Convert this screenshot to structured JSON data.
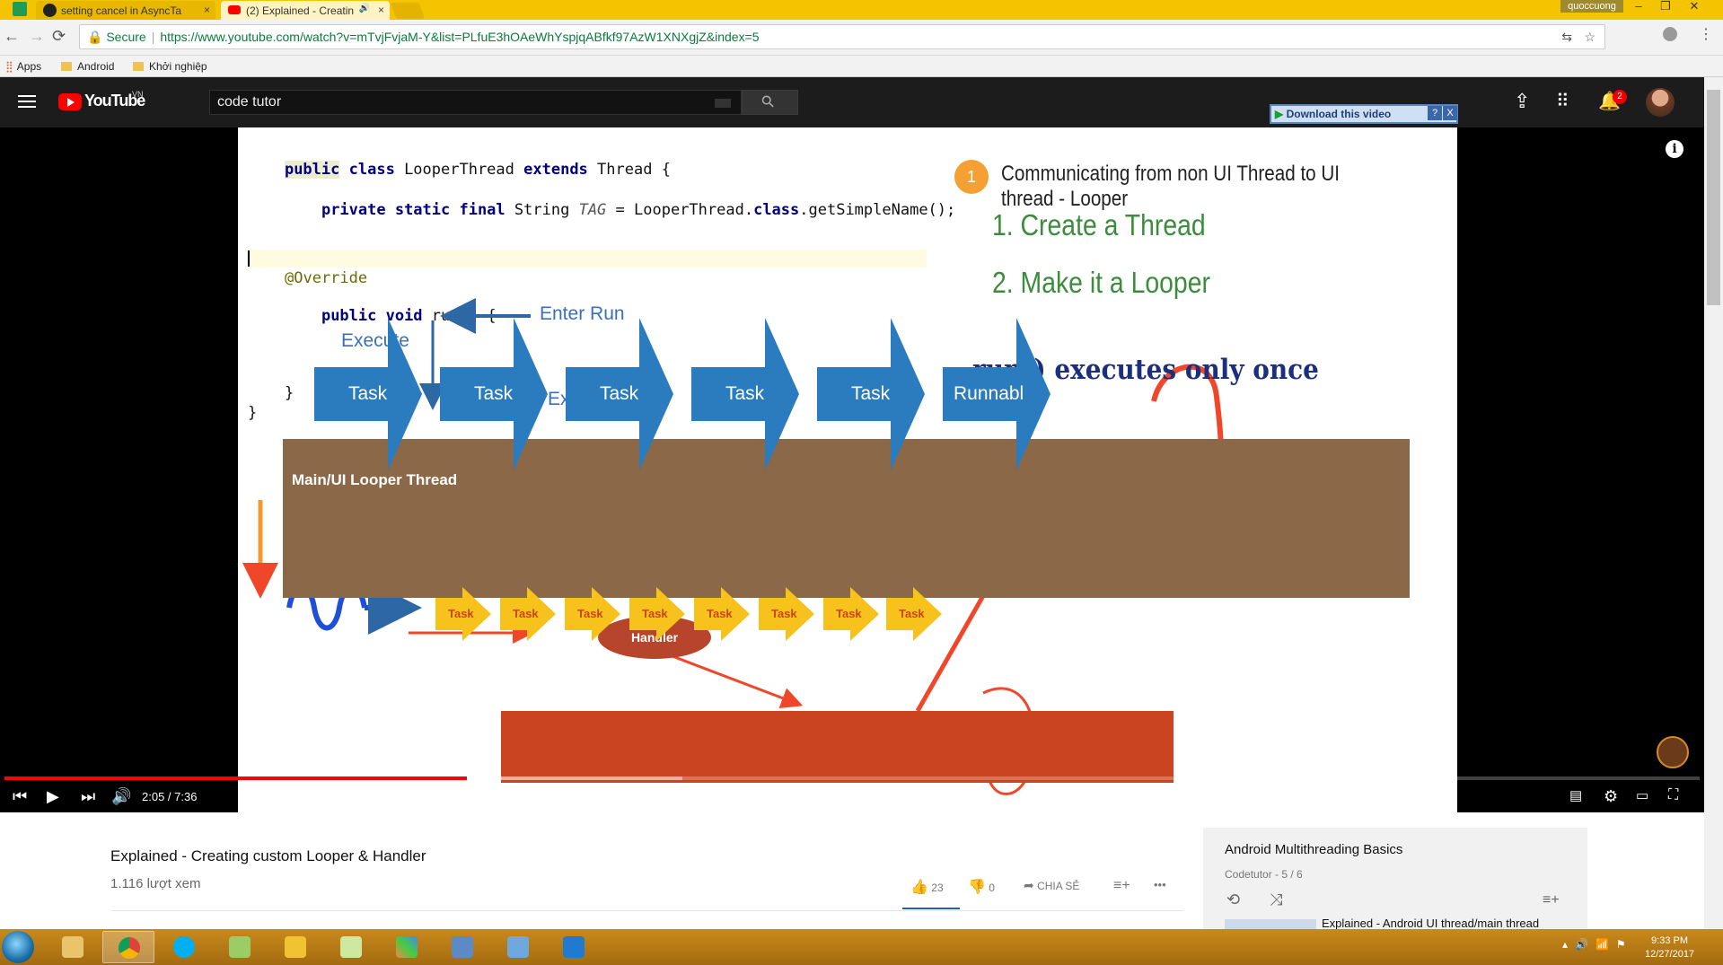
{
  "browser": {
    "tabs": [
      {
        "title": "setting cancel in AsyncTa",
        "icon": "github-icon",
        "close": "×"
      },
      {
        "title": "(2) Explained - Creatin",
        "icon": "youtube-icon",
        "close": "×",
        "audio": "🔊"
      }
    ],
    "user": "quoccuong",
    "window_controls": [
      "–",
      "❐",
      "✕"
    ],
    "nav": {
      "back": "←",
      "forward": "→",
      "reload": "⟳"
    },
    "secure_label": "Secure",
    "url": "https://www.youtube.com/watch?v=mTvjFvjaM-Y&list=PLfuE3hOAeWhYspjqABfkf97AzW1XNXgjZ&index=5",
    "bookmarks": [
      {
        "label": "Apps",
        "icon": "apps-grid-icon"
      },
      {
        "label": "Android",
        "icon": "folder-icon"
      },
      {
        "label": "Khởi nghiệp",
        "icon": "folder-icon"
      }
    ]
  },
  "youtube": {
    "logo_text": "YouTube",
    "region": "VN",
    "search_value": "code tutor",
    "download_button": "Download this video",
    "download_help": "?",
    "download_close": "X",
    "notification_count": "2"
  },
  "slide": {
    "code": {
      "line1_kw1": "public",
      "line1_kw2": "class",
      "line1_name": "LooperThread",
      "line1_kw3": "extends",
      "line1_rest": "Thread {",
      "line2_kw": "private static final",
      "line2_type": "String",
      "line2_tag": "TAG",
      "line2_mid": "= LooperThread.",
      "line2_kw2": "class",
      "line2_end": ".getSimpleName();",
      "override": "@Override",
      "run_kw": "public void",
      "run_rest": "run() {",
      "close_inner": "}",
      "close_outer": "}"
    },
    "enter_run": "Enter Run",
    "execute": "Execute",
    "exit_run": "Exit Run",
    "step_number": "1",
    "heading": "Communicating from non UI Thread to UI thread - Looper",
    "step1": "1. Create a Thread",
    "step2": "2. Make it a Looper",
    "run_once": "run() executes only once",
    "looper_label": "Main/UI Looper Thread",
    "tasks": [
      "Task",
      "Task",
      "Task",
      "Task",
      "Task",
      "Runnabl"
    ],
    "handler": "Handler",
    "queue_tasks": [
      "Task",
      "Task",
      "Task",
      "Task",
      "Task",
      "Task",
      "Task",
      "Task"
    ]
  },
  "player": {
    "time": "2:05 / 7:36",
    "progress_fraction": 0.273,
    "buffered_fraction": 0.4
  },
  "video": {
    "title": "Explained - Creating custom Looper & Handler",
    "views": "1.116 lượt xem",
    "likes": "23",
    "dislikes": "0",
    "share": "CHIA SẺ",
    "more": "•••"
  },
  "playlist": {
    "title": "Android Multithreading Basics",
    "meta": "Codetutor - 5 / 6",
    "next_title": "Explained - Android UI thread/main thread"
  },
  "taskbar": {
    "time": "9:33 PM",
    "date": "12/27/2017"
  },
  "colors": {
    "chrome_yellow": "#f5c400",
    "yt_red": "#ff0000",
    "task_blue": "#2b7bbf",
    "board_brown": "#8a6848",
    "queue_red": "#c9441f",
    "step_green": "#3d8b3d"
  }
}
